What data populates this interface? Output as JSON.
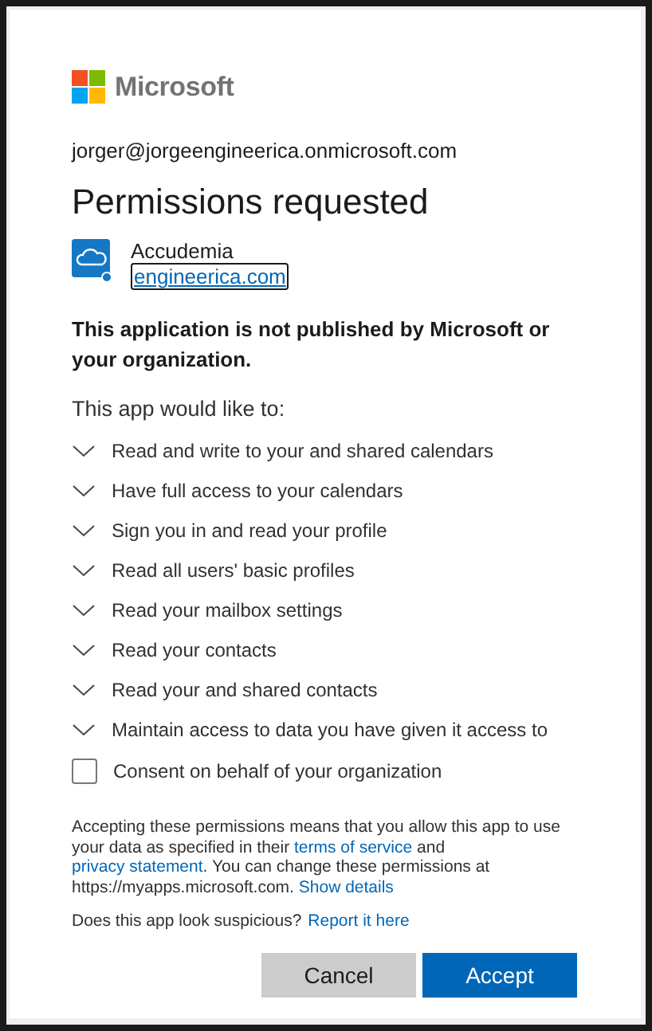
{
  "brand": {
    "name": "Microsoft"
  },
  "account": "jorger@jorgeengineerica.onmicrosoft.com",
  "title": "Permissions requested",
  "app": {
    "name": "Accudemia",
    "publisher_link": "engineerica.com"
  },
  "warning": "This application is not published by Microsoft or your organization.",
  "intro": "This app would like to:",
  "permissions": [
    {
      "label": "Read and write to your and shared calendars",
      "expanded": false
    },
    {
      "label": "Have full access to your calendars",
      "expanded": false
    },
    {
      "label": "Sign you in and read your profile",
      "expanded": false
    },
    {
      "label": "Read all users' basic profiles",
      "expanded": false
    },
    {
      "label": "Read your mailbox settings",
      "expanded": false
    },
    {
      "label": "Read your contacts",
      "expanded": false
    },
    {
      "label": "Read your and shared contacts",
      "expanded": false
    },
    {
      "label": "Maintain access to data you have given it access to",
      "expanded": false
    }
  ],
  "consent": {
    "label": "Consent on behalf of your organization",
    "checked": false
  },
  "legal": [
    {
      "kind": "text",
      "text": "Accepting these permissions means that you allow this app to use your data as specified in their "
    },
    {
      "kind": "link",
      "text": "terms of service"
    },
    {
      "kind": "text",
      "text": " and "
    },
    {
      "kind": "link",
      "text": "privacy statement"
    },
    {
      "kind": "text",
      "text": ". You can change these permissions at https://myapps.microsoft.com. "
    },
    {
      "kind": "link",
      "text": "Show details"
    }
  ],
  "suspicious": {
    "text": "Does this app look suspicious?",
    "link": "Report it here"
  },
  "buttons": [
    {
      "label": "Cancel",
      "kind": "secondary"
    },
    {
      "label": "Accept",
      "kind": "primary"
    }
  ]
}
